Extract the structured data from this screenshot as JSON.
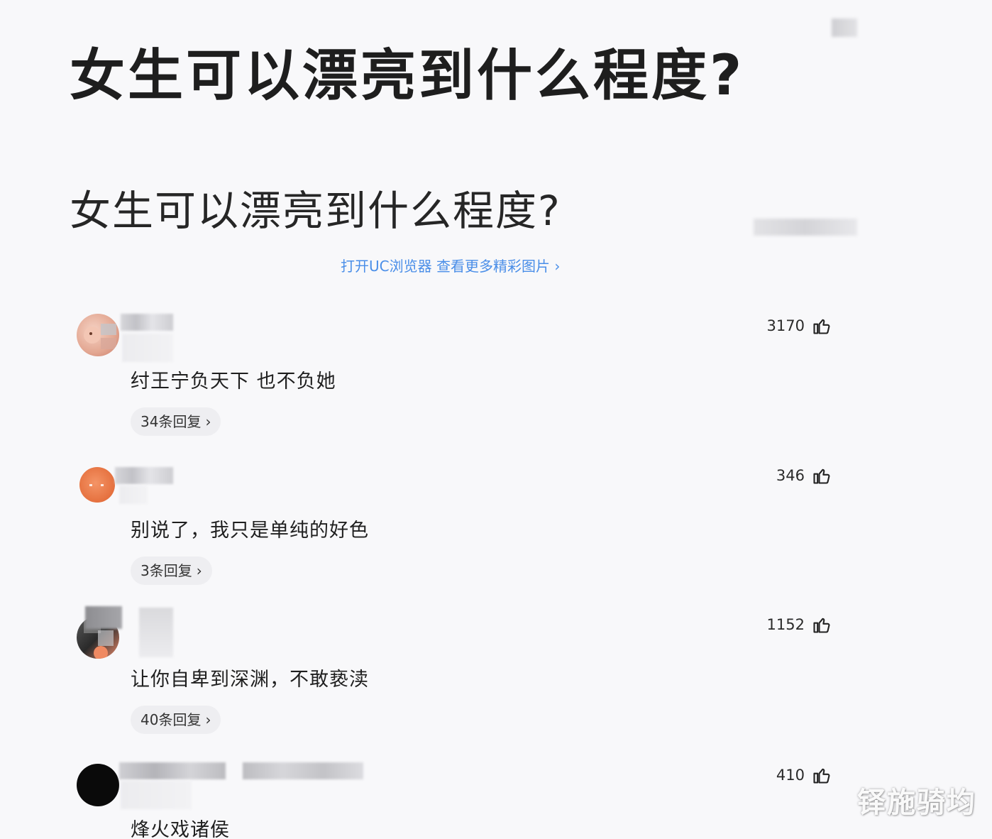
{
  "post": {
    "title": "女生可以漂亮到什么程度?",
    "subtitle": "女生可以漂亮到什么程度?",
    "open_link": "打开UC浏览器 查看更多精彩图片 ›"
  },
  "comments": [
    {
      "likes": "3170",
      "text": "纣王宁负天下 也不负她",
      "replies": "34条回复",
      "chevron": "›",
      "avatar_color": "#e8b8a8"
    },
    {
      "likes": "346",
      "text": "别说了，我只是单纯的好色",
      "replies": "3条回复",
      "chevron": "›",
      "avatar_color": "#e87a4a"
    },
    {
      "likes": "1152",
      "text": "让你自卑到深渊，不敢亵渎",
      "replies": "40条回复",
      "chevron": "›",
      "avatar_color": "#3a3a3a"
    },
    {
      "likes": "410",
      "text": "烽火戏诸侯",
      "avatar_color": "#0a0a0a"
    }
  ],
  "watermark": "铎施骑均",
  "colors": {
    "link": "#4a8ee8",
    "background": "#f8f8fa"
  },
  "icons": {
    "like": "thumbs-up-icon"
  }
}
